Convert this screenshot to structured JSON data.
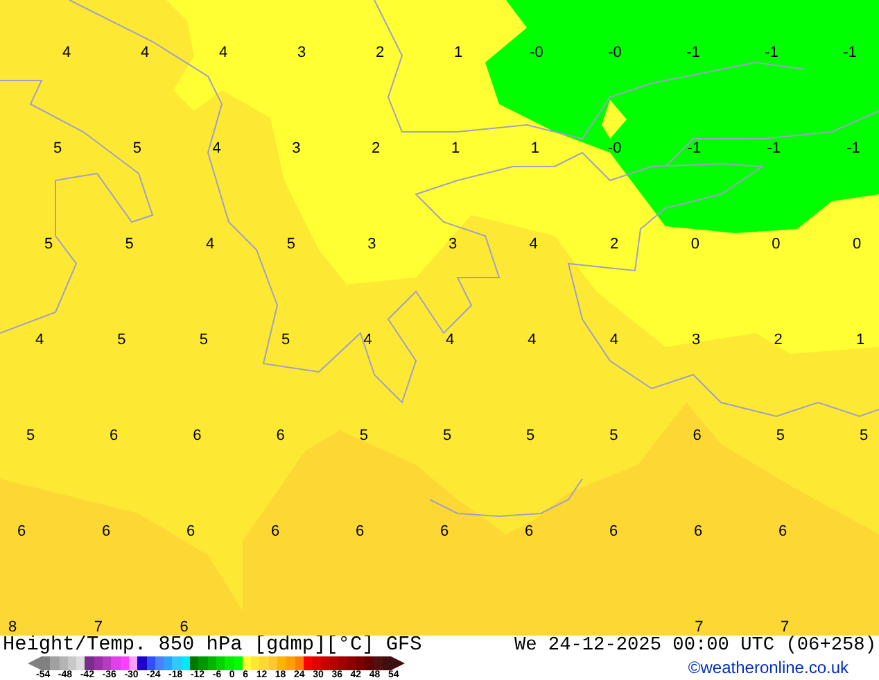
{
  "map": {
    "label_rows": [
      [
        "4",
        "4",
        "4",
        "3",
        "2",
        "1",
        "-0",
        "-0",
        "-1",
        "-1",
        "-1"
      ],
      [
        "5",
        "5",
        "4",
        "3",
        "2",
        "1",
        "1",
        "-0",
        "-1",
        "-1",
        "-1"
      ],
      [
        "5",
        "5",
        "4",
        "5",
        "3",
        "3",
        "4",
        "2",
        "0",
        "0",
        "0"
      ],
      [
        "4",
        "5",
        "5",
        "5",
        "4",
        "4",
        "4",
        "4",
        "3",
        "2",
        "1"
      ],
      [
        "5",
        "6",
        "6",
        "6",
        "5",
        "5",
        "5",
        "5",
        "6",
        "5",
        "5"
      ],
      [
        "6",
        "6",
        "6",
        "6",
        "6",
        "6",
        "6",
        "6",
        "6",
        "6"
      ],
      [
        "8",
        "7",
        "6",
        null,
        null,
        null,
        null,
        null,
        "7",
        "7"
      ]
    ]
  },
  "footer": {
    "title": "Height/Temp. 850 hPa [gdmp][°C] GFS",
    "date": "We 24-12-2025 00:00 UTC (06+258)",
    "credit": "©weatheronline.co.uk",
    "color_scale": {
      "swatches": [
        {
          "color": "#808080"
        },
        {
          "color": "#a0a0a0"
        },
        {
          "color": "#b4b4b4"
        },
        {
          "color": "#c8c8c8"
        },
        {
          "color": "#dcdcdc"
        },
        {
          "color": "#7a2d8a"
        },
        {
          "color": "#9b30a8"
        },
        {
          "color": "#b43cc0"
        },
        {
          "color": "#e040e8"
        },
        {
          "color": "#ff40ff"
        },
        {
          "color": "#ffa0ff"
        },
        {
          "color": "#1e00c8"
        },
        {
          "color": "#3050ff"
        },
        {
          "color": "#4a80ff"
        },
        {
          "color": "#30a0ff"
        },
        {
          "color": "#30c8ff"
        },
        {
          "color": "#00e8ff"
        },
        {
          "color": "#007800"
        },
        {
          "color": "#009600"
        },
        {
          "color": "#00b400"
        },
        {
          "color": "#00d200"
        },
        {
          "color": "#00f000"
        },
        {
          "color": "#00ff00"
        },
        {
          "color": "#ffff30"
        },
        {
          "color": "#ffe830"
        },
        {
          "color": "#ffd830"
        },
        {
          "color": "#ffc830"
        },
        {
          "color": "#ffb400"
        },
        {
          "color": "#ffa000"
        },
        {
          "color": "#ff8000"
        },
        {
          "color": "#ff0000"
        },
        {
          "color": "#e00000"
        },
        {
          "color": "#c80000"
        },
        {
          "color": "#b40000"
        },
        {
          "color": "#a00000"
        },
        {
          "color": "#8c0000"
        },
        {
          "color": "#780000"
        },
        {
          "color": "#640000"
        },
        {
          "color": "#501010"
        },
        {
          "color": "#401010"
        }
      ],
      "ticks": [
        "-54",
        "-48",
        "-42",
        "-36",
        "-30",
        "-24",
        "-18",
        "-12",
        "-6",
        "0",
        "6",
        "12",
        "18",
        "24",
        "30",
        "36",
        "42",
        "48",
        "54"
      ]
    }
  }
}
